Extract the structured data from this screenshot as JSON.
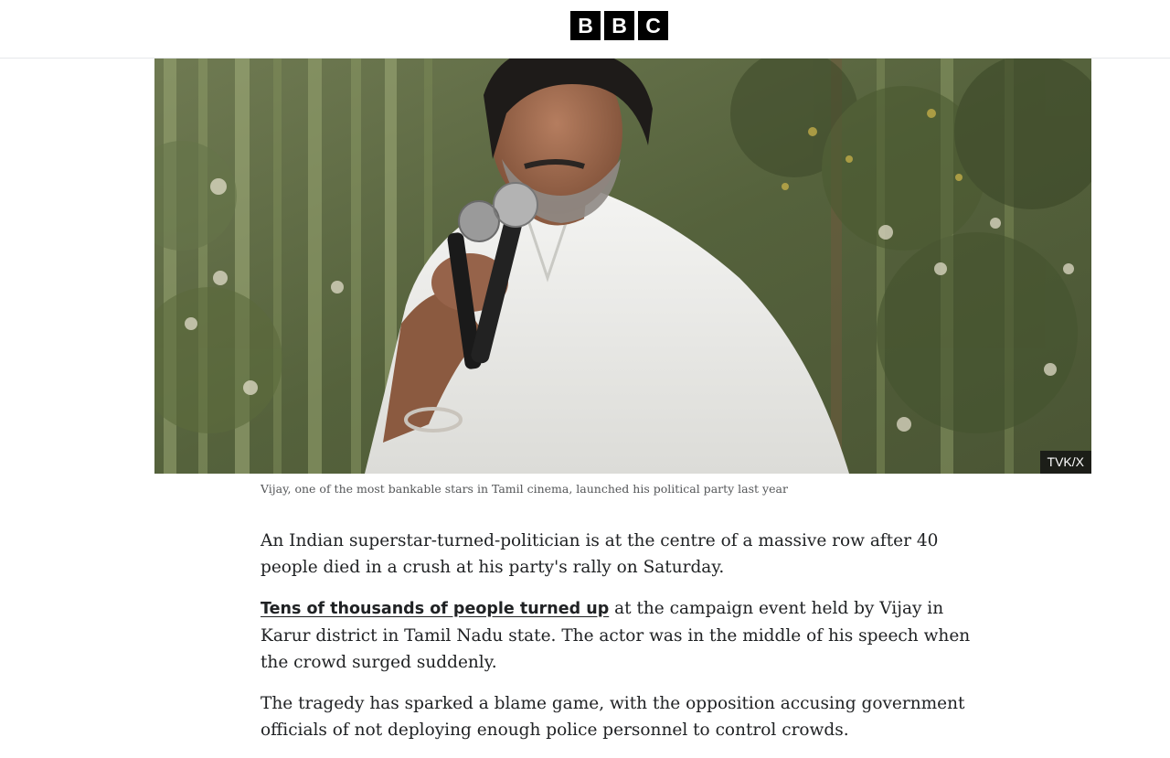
{
  "header": {
    "logo_letters": [
      "B",
      "B",
      "C"
    ]
  },
  "hero": {
    "image_subject": "man in white shirt speaking into two microphones outdoors in front of bamboo",
    "credit": "TVK/X",
    "caption": "Vijay, one of the most bankable stars in Tamil cinema, launched his political party last year"
  },
  "article": {
    "para1": "An Indian superstar-turned-politician is at the centre of a massive row after 40 people died in a crush at his party's rally on Saturday.",
    "para2_link": "Tens of thousands of people turned up",
    "para2_rest": " at the campaign event held by Vijay in Karur district in Tamil Nadu state. The actor was in the middle of his speech when the crowd surged suddenly.",
    "para3": "The tragedy has sparked a blame game, with the opposition accusing government officials of not deploying enough police personnel to control crowds."
  },
  "colors": {
    "logo_bg": "#000000",
    "text": "#202224",
    "caption": "#545658",
    "credit_bg": "#141414"
  }
}
